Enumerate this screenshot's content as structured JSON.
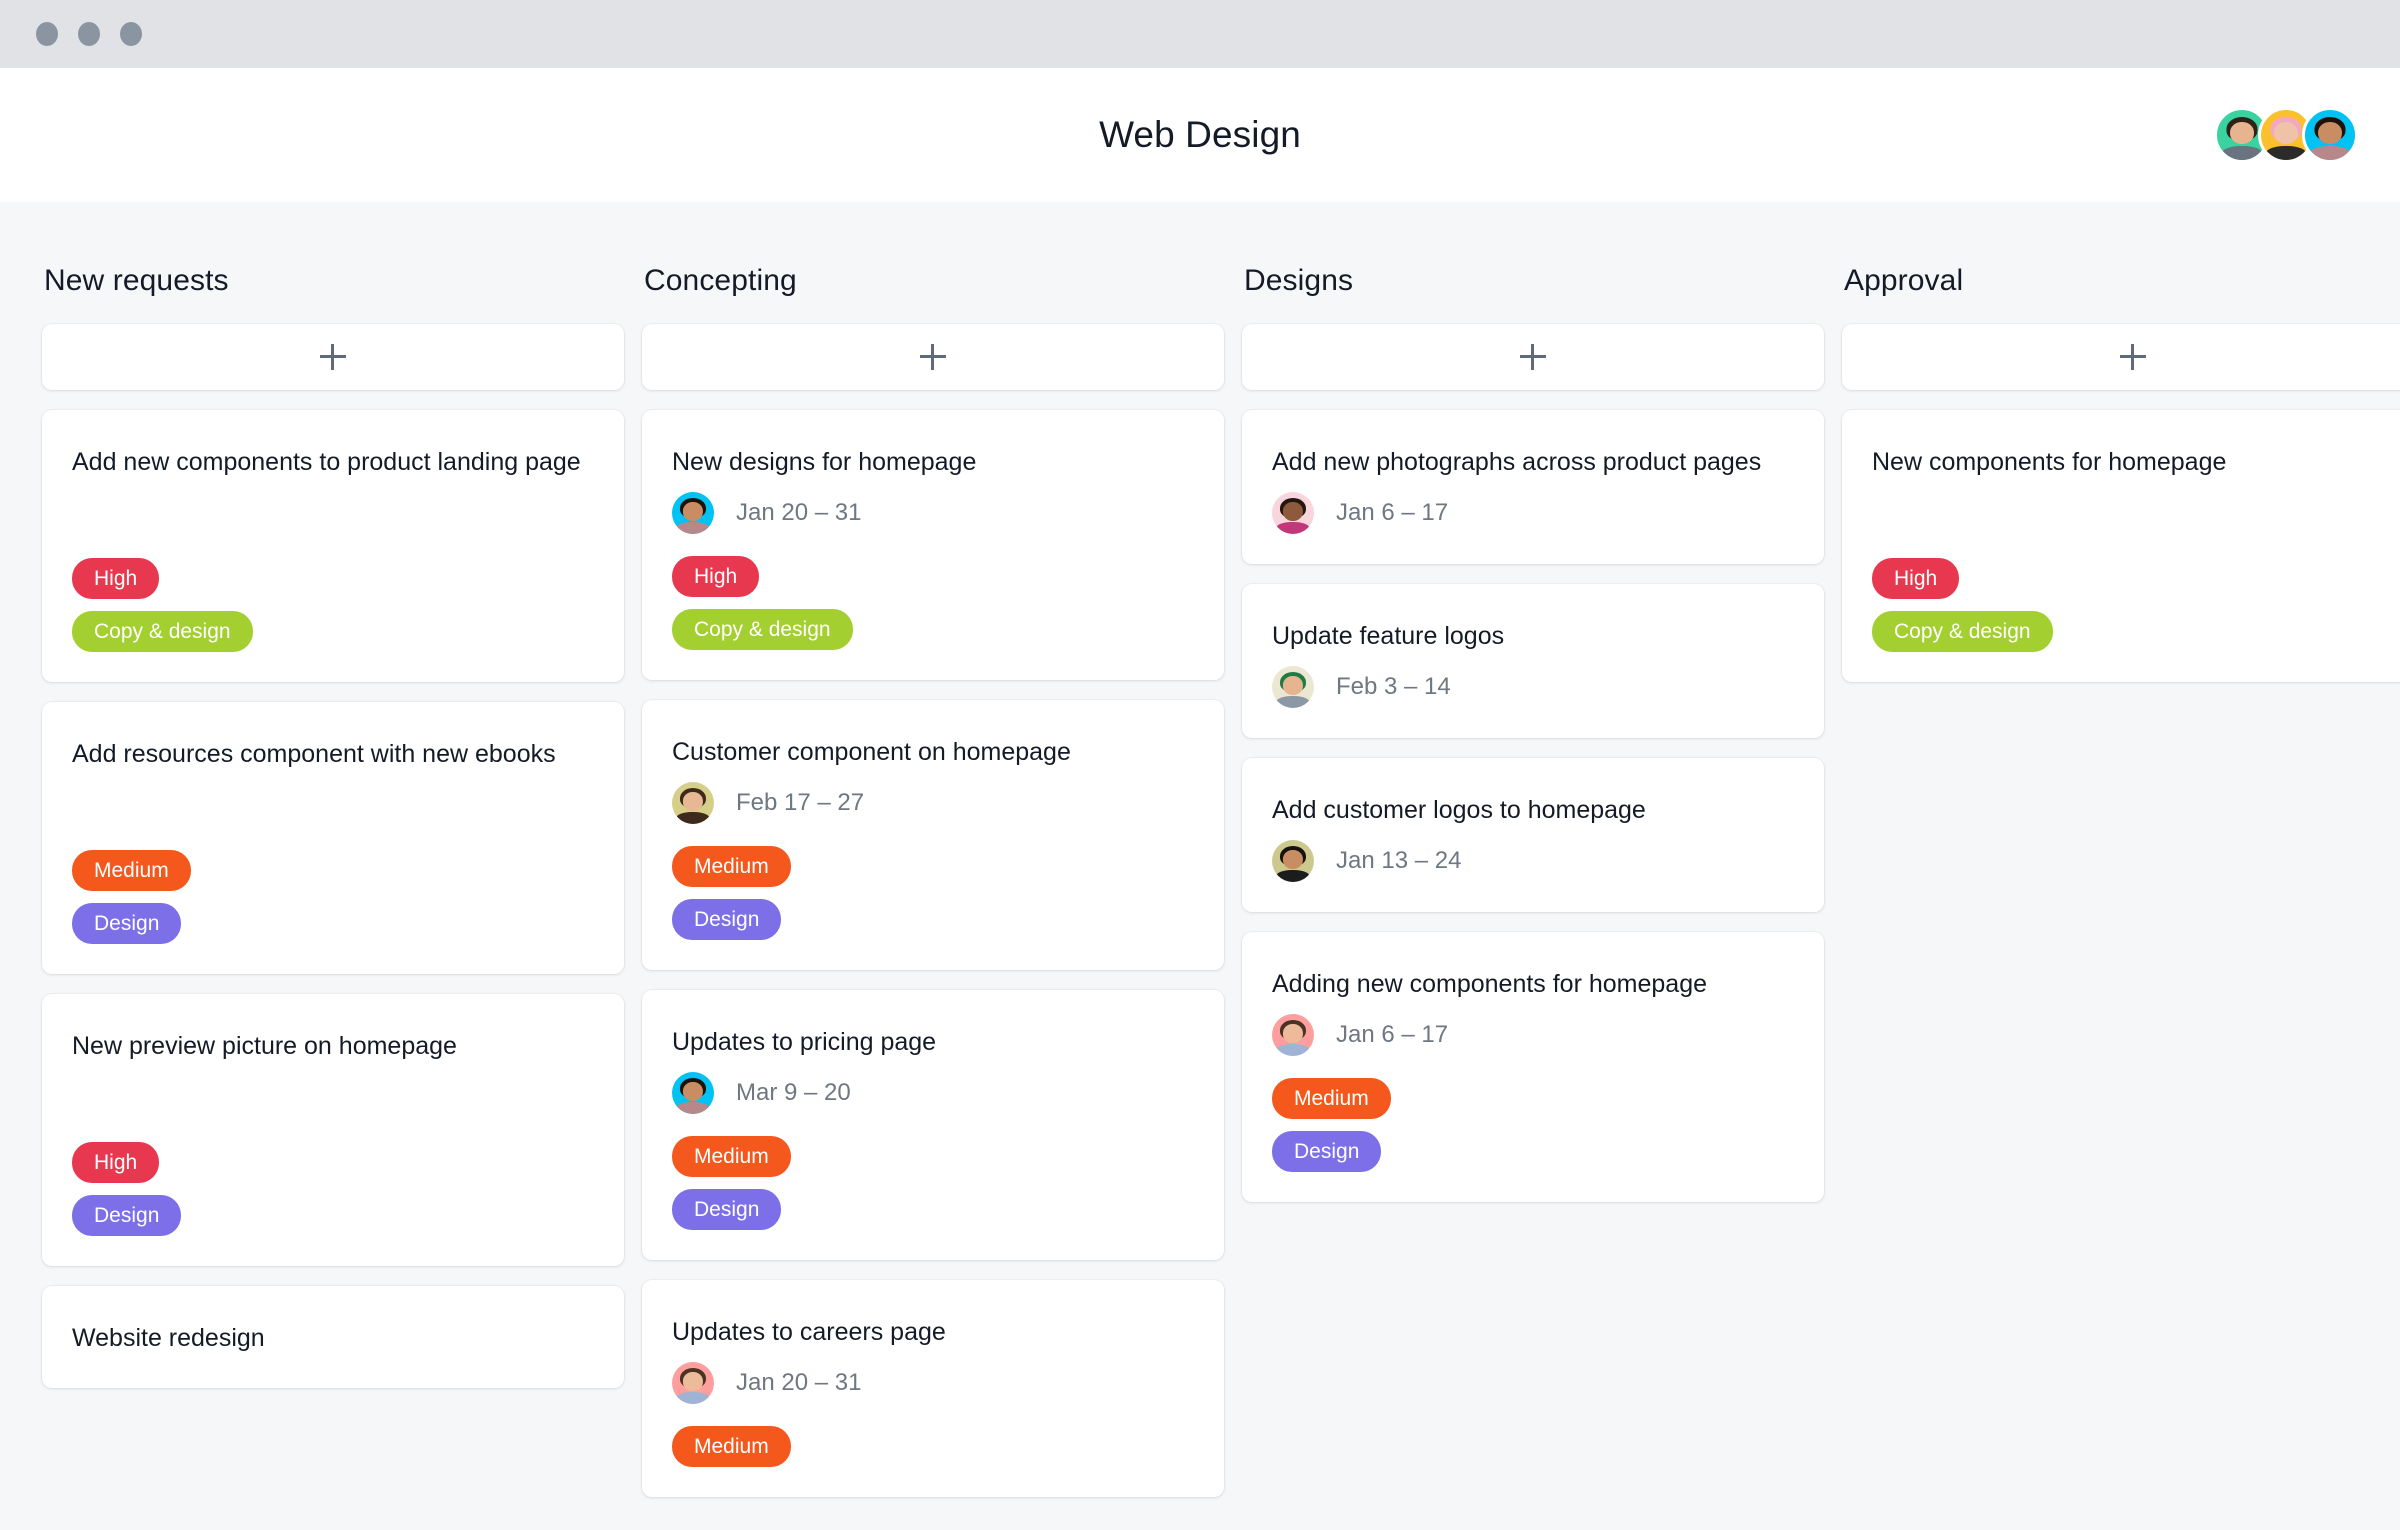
{
  "window": {
    "dots": [
      "close-dot",
      "minimize-dot",
      "maximize-dot"
    ]
  },
  "header": {
    "title": "Web Design",
    "members": [
      {
        "name": "member-avatar-1",
        "bg": "#3ad29f",
        "hair": "#2f2218",
        "skin": "#e6b48e",
        "body": "#6b7280",
        "hat": "#1f7a46"
      },
      {
        "name": "member-avatar-2",
        "bg": "#fbc02d",
        "hair": "#f2a7c3",
        "skin": "#f0c3a8",
        "body": "#2b2b2b",
        "hat": ""
      },
      {
        "name": "member-avatar-3",
        "bg": "#00c2f3",
        "hair": "#1d1208",
        "skin": "#c98d63",
        "body": "#b8878a",
        "hat": ""
      }
    ]
  },
  "tag_colors": {
    "high": "#e8384f",
    "medium": "#f4581c",
    "copy_design": "#a4cf30",
    "design": "#7c6fe8"
  },
  "add_card_label": "+",
  "columns": [
    {
      "title": "New requests",
      "cards": [
        {
          "title": "Add new components to product landing page",
          "assignee": null,
          "date": null,
          "tags": [
            {
              "label": "High",
              "color_key": "high"
            },
            {
              "label": "Copy & design",
              "color_key": "copy_design"
            }
          ]
        },
        {
          "title": "Add resources component with new ebooks",
          "assignee": null,
          "date": null,
          "tags": [
            {
              "label": "Medium",
              "color_key": "medium"
            },
            {
              "label": "Design",
              "color_key": "design"
            }
          ]
        },
        {
          "title": "New preview picture on homepage",
          "assignee": null,
          "date": null,
          "tags": [
            {
              "label": "High",
              "color_key": "high"
            },
            {
              "label": "Design",
              "color_key": "design"
            }
          ]
        },
        {
          "title": "Website redesign",
          "assignee": null,
          "date": null,
          "tags": []
        }
      ]
    },
    {
      "title": "Concepting",
      "cards": [
        {
          "title": "New designs for homepage",
          "assignee": {
            "name": "avatar-cyan-man",
            "bg": "#00c2f3",
            "hair": "#1d1208",
            "skin": "#c98d63",
            "body": "#b8878a"
          },
          "date": "Jan 20 – 31",
          "tags": [
            {
              "label": "High",
              "color_key": "high"
            },
            {
              "label": "Copy & design",
              "color_key": "copy_design"
            }
          ]
        },
        {
          "title": "Customer component on homepage",
          "assignee": {
            "name": "avatar-gold-woman",
            "bg": "#d6cf8a",
            "hair": "#3d2a1d",
            "skin": "#e8b894",
            "body": "#3d2a1d"
          },
          "date": "Feb 17 – 27",
          "tags": [
            {
              "label": "Medium",
              "color_key": "medium"
            },
            {
              "label": "Design",
              "color_key": "design"
            }
          ]
        },
        {
          "title": "Updates to pricing page",
          "assignee": {
            "name": "avatar-cyan-man",
            "bg": "#00c2f3",
            "hair": "#1d1208",
            "skin": "#c98d63",
            "body": "#b8878a"
          },
          "date": "Mar 9 – 20",
          "tags": [
            {
              "label": "Medium",
              "color_key": "medium"
            },
            {
              "label": "Design",
              "color_key": "design"
            }
          ]
        },
        {
          "title": "Updates to careers page",
          "assignee": {
            "name": "avatar-pink-man",
            "bg": "#ff9e9e",
            "hair": "#4a3322",
            "skin": "#edbb9a",
            "body": "#9fb4d4"
          },
          "date": "Jan 20 – 31",
          "tags": [
            {
              "label": "Medium",
              "color_key": "medium"
            }
          ]
        }
      ]
    },
    {
      "title": "Designs",
      "cards": [
        {
          "title": "Add new photographs across product pages",
          "assignee": {
            "name": "avatar-pink-woman",
            "bg": "#f9d5dd",
            "hair": "#241710",
            "skin": "#8d5a3b",
            "body": "#c0387a"
          },
          "date": "Jan 6 – 17",
          "tags": []
        },
        {
          "title": "Update feature logos",
          "assignee": {
            "name": "avatar-green-hat-person",
            "bg": "#ece7d2",
            "hair": "#1f7a46",
            "skin": "#e6b48e",
            "body": "#8d98a5"
          },
          "date": "Feb 3 – 14",
          "tags": []
        },
        {
          "title": "Add customer logos to homepage",
          "assignee": {
            "name": "avatar-olive-man",
            "bg": "#cdc98e",
            "hair": "#18120c",
            "skin": "#c98d63",
            "body": "#1c1c1c"
          },
          "date": "Jan 13 – 24",
          "tags": []
        },
        {
          "title": "Adding new components for homepage",
          "assignee": {
            "name": "avatar-pink-man",
            "bg": "#ff9e9e",
            "hair": "#4a3322",
            "skin": "#edbb9a",
            "body": "#9fb4d4"
          },
          "date": "Jan 6 – 17",
          "tags": [
            {
              "label": "Medium",
              "color_key": "medium"
            },
            {
              "label": "Design",
              "color_key": "design"
            }
          ]
        }
      ]
    },
    {
      "title": "Approval",
      "cards": [
        {
          "title": "New components for homepage",
          "assignee": null,
          "date": null,
          "tags": [
            {
              "label": "High",
              "color_key": "high"
            },
            {
              "label": "Copy & design",
              "color_key": "copy_design"
            }
          ]
        }
      ]
    }
  ]
}
